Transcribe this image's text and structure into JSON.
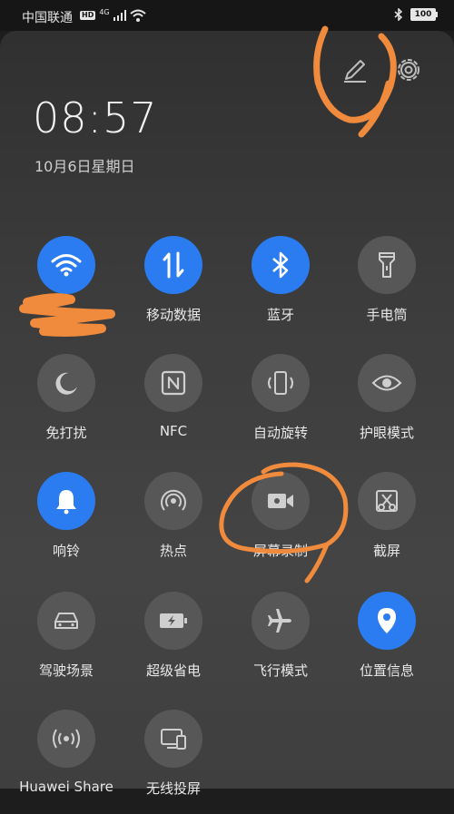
{
  "status_bar": {
    "carrier": "中国联通",
    "hd": "HD",
    "network_type": "4G",
    "battery": "100"
  },
  "panel": {
    "time": "08:57",
    "date": "10月6日星期日"
  },
  "tiles": [
    {
      "label": "",
      "icon": "wifi-icon",
      "active": true
    },
    {
      "label": "移动数据",
      "icon": "mobile-data-icon",
      "active": true
    },
    {
      "label": "蓝牙",
      "icon": "bluetooth-icon",
      "active": true
    },
    {
      "label": "手电筒",
      "icon": "flashlight-icon",
      "active": false
    },
    {
      "label": "免打扰",
      "icon": "moon-icon",
      "active": false
    },
    {
      "label": "NFC",
      "icon": "nfc-icon",
      "active": false
    },
    {
      "label": "自动旋转",
      "icon": "auto-rotate-icon",
      "active": false
    },
    {
      "label": "护眼模式",
      "icon": "eye-icon",
      "active": false
    },
    {
      "label": "响铃",
      "icon": "bell-icon",
      "active": true
    },
    {
      "label": "热点",
      "icon": "hotspot-icon",
      "active": false
    },
    {
      "label": "屏幕录制",
      "icon": "video-camera-icon",
      "active": false
    },
    {
      "label": "截屏",
      "icon": "screenshot-icon",
      "active": false
    },
    {
      "label": "驾驶场景",
      "icon": "car-icon",
      "active": false
    },
    {
      "label": "超级省电",
      "icon": "battery-saver-icon",
      "active": false
    },
    {
      "label": "飞行模式",
      "icon": "airplane-icon",
      "active": false
    },
    {
      "label": "位置信息",
      "icon": "location-icon",
      "active": true
    },
    {
      "label": "Huawei Share",
      "icon": "huawei-share-icon",
      "active": false
    },
    {
      "label": "无线投屏",
      "icon": "wireless-projection-icon",
      "active": false
    }
  ],
  "colors": {
    "accent": "#2a7cf0",
    "tile_inactive": "#575757",
    "annotation": "#f08a3c"
  }
}
